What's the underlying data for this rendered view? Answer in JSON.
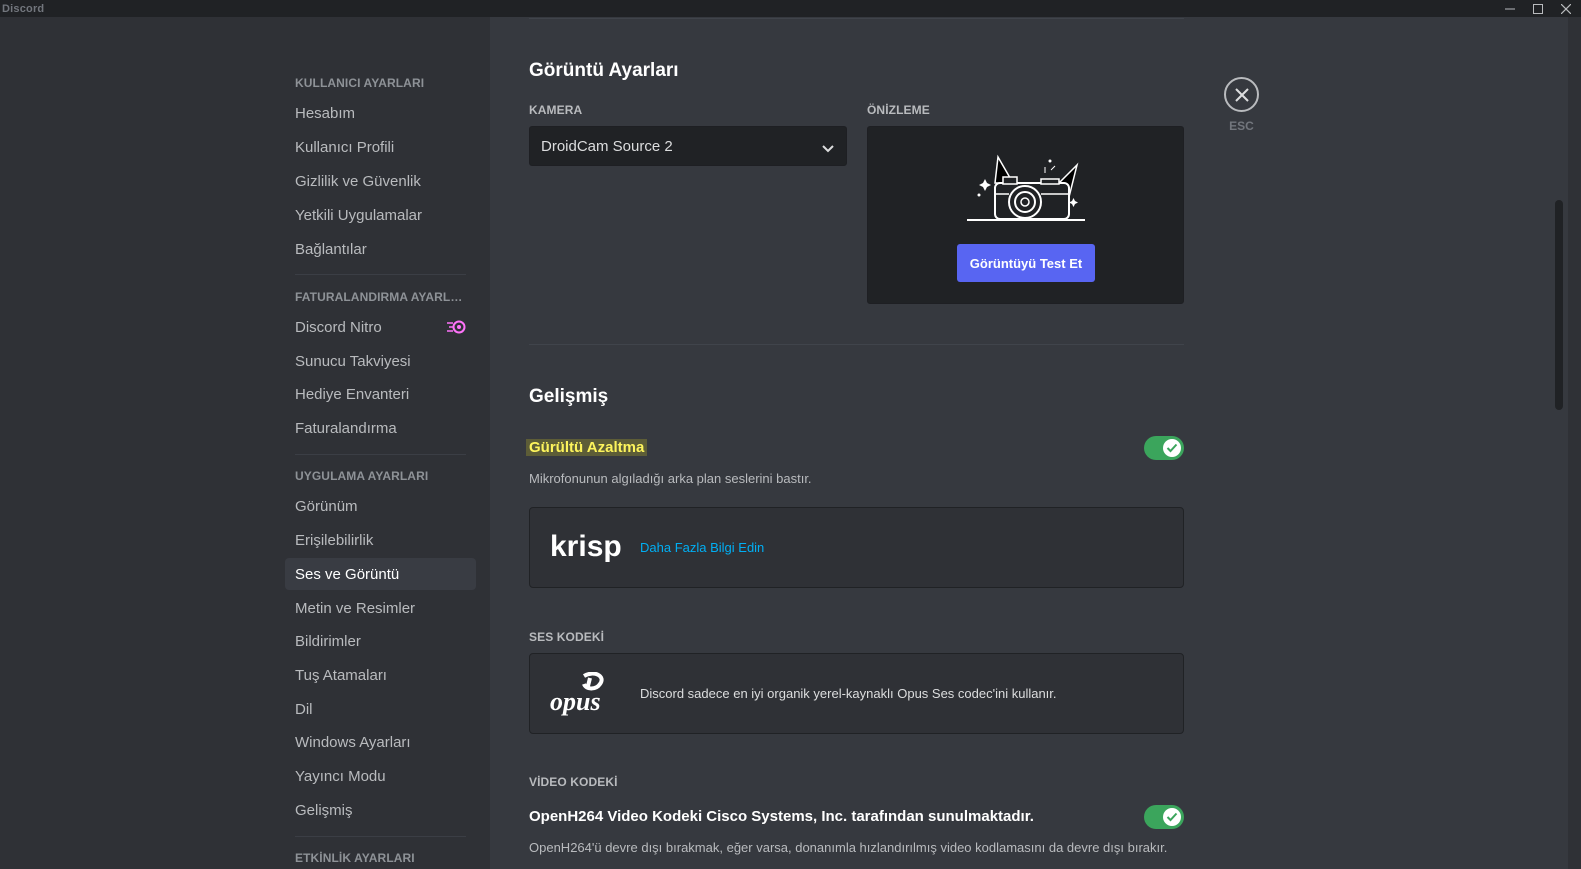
{
  "window": {
    "title": "Discord",
    "controls": [
      "minimize-icon",
      "maximize-icon",
      "close-icon"
    ]
  },
  "sidebar": {
    "sections": [
      {
        "header": "KULLANICI AYARLARI",
        "items": [
          "Hesabım",
          "Kullanıcı Profili",
          "Gizlilik ve Güvenlik",
          "Yetkili Uygulamalar",
          "Bağlantılar"
        ]
      },
      {
        "header": "FATURALANDIRMA AYARLA...",
        "items": [
          "Discord Nitro",
          "Sunucu Takviyesi",
          "Hediye Envanteri",
          "Faturalandırma"
        ]
      },
      {
        "header": "UYGULAMA AYARLARI",
        "items": [
          "Görünüm",
          "Erişilebilirlik",
          "Ses ve Görüntü",
          "Metin ve Resimler",
          "Bildirimler",
          "Tuş Atamaları",
          "Dil",
          "Windows Ayarları",
          "Yayıncı Modu",
          "Gelişmiş"
        ]
      },
      {
        "header": "ETKİNLİK AYARLARI",
        "items": []
      }
    ],
    "active_item": "Ses ve Görüntü",
    "nitro_icon": "nitro-icon"
  },
  "video": {
    "title": "Görüntü Ayarları",
    "camera_label": "KAMERA",
    "camera_value": "DroidCam Source 2",
    "preview_label": "ÖNİZLEME",
    "test_button": "Görüntüyü Test Et"
  },
  "advanced": {
    "title": "Gelişmiş",
    "noise": {
      "title": "Gürültü Azaltma",
      "description": "Mikrofonunun algıladığı arka plan seslerini bastır.",
      "enabled": true
    },
    "krisp": {
      "logo_text": "krisp",
      "link": "Daha Fazla Bilgi Edin"
    },
    "audio_codec": {
      "label": "SES KODEKİ",
      "logo_text": "opus",
      "text": "Discord sadece en iyi organik yerel-kaynaklı Opus Ses codec'ini kullanır."
    },
    "video_codec": {
      "label": "VİDEO KODEKİ",
      "title": "OpenH264 Video Kodeki Cisco Systems, Inc. tarafından sunulmaktadır.",
      "description": "OpenH264'ü devre dışı bırakmak, eğer varsa, donanımla hızlandırılmış video kodlamasını da devre dışı bırakır.",
      "enabled": true
    }
  },
  "close": {
    "label": "ESC"
  },
  "colors": {
    "accent": "#5865f2",
    "toggle_on": "#3ba55c",
    "link": "#00aff4",
    "nitro": "#ff73fa"
  }
}
